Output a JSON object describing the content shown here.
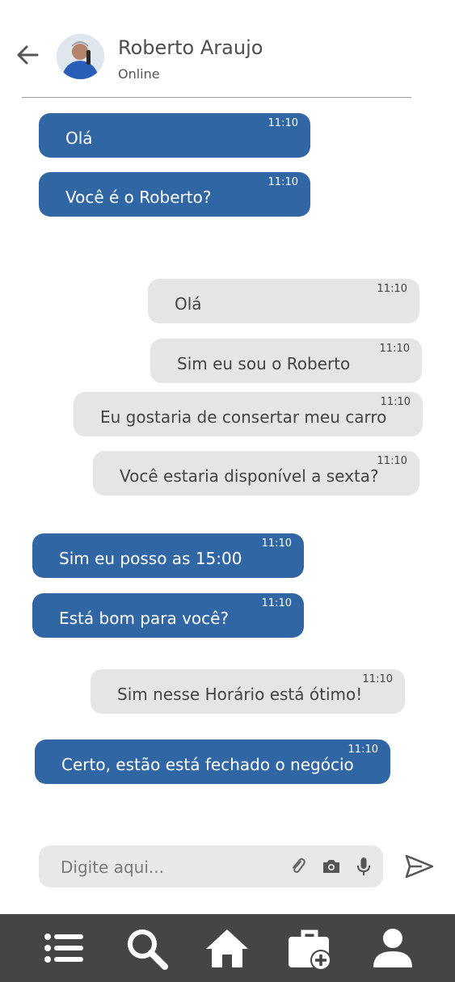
{
  "contact": {
    "name": "Roberto Araujo",
    "status": "Online"
  },
  "messages": [
    {
      "text": "Olá",
      "time": "11:10",
      "dir": "out"
    },
    {
      "text": "Você é o Roberto?",
      "time": "11:10",
      "dir": "out"
    },
    {
      "text": "Olá",
      "time": "11:10",
      "dir": "in"
    },
    {
      "text": "Sim eu sou o Roberto",
      "time": "11:10",
      "dir": "in"
    },
    {
      "text": "Eu gostaria de consertar meu carro",
      "time": "11:10",
      "dir": "in"
    },
    {
      "text": "Você estaria disponível a sexta?",
      "time": "11:10",
      "dir": "in"
    },
    {
      "text": "Sim eu posso as 15:00",
      "time": "11:10",
      "dir": "out"
    },
    {
      "text": "Está bom para você?",
      "time": "11:10",
      "dir": "out"
    },
    {
      "text": "Sim nesse Horário está ótimo!",
      "time": "11:10",
      "dir": "in"
    },
    {
      "text": "Certo, estão está fechado o negócio",
      "time": "11:10",
      "dir": "out"
    }
  ],
  "composer": {
    "placeholder": "Digite aqui..."
  },
  "icons": {
    "back": "arrow-left-icon",
    "attach": "paperclip-icon",
    "camera": "camera-icon",
    "mic": "microphone-icon",
    "send": "send-icon",
    "nav": [
      "list-icon",
      "search-icon",
      "home-icon",
      "briefcase-add-icon",
      "profile-icon"
    ]
  },
  "colors": {
    "outgoing_bubble": "#2f66a3",
    "incoming_bubble": "#e5e5e5",
    "nav_background": "#454545"
  }
}
